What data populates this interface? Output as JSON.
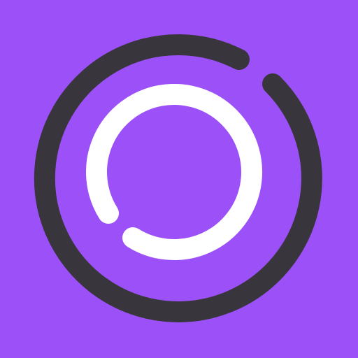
{
  "icon": {
    "name": "loading-rings-app-icon",
    "colors": {
      "background": "#9B51F7",
      "outer_ring": "#38363C",
      "inner_ring": "#FFFFFF"
    }
  }
}
